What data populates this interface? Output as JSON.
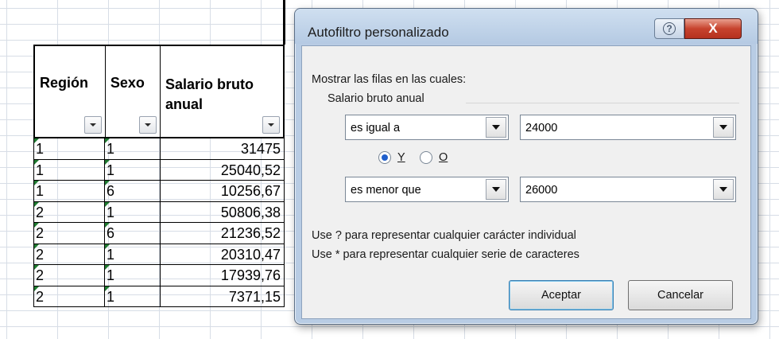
{
  "sheet": {
    "headers": [
      {
        "label": "Región"
      },
      {
        "label": "Sexo"
      },
      {
        "label_line1": "Salario bruto",
        "label_line2": "anual"
      }
    ],
    "rows": [
      {
        "region": "1",
        "sexo": "1",
        "salario": "31475"
      },
      {
        "region": "1",
        "sexo": "1",
        "salario": "25040,52"
      },
      {
        "region": "1",
        "sexo": "6",
        "salario": "10256,67"
      },
      {
        "region": "2",
        "sexo": "1",
        "salario": "50806,38"
      },
      {
        "region": "2",
        "sexo": "6",
        "salario": "21236,52"
      },
      {
        "region": "2",
        "sexo": "1",
        "salario": "20310,47"
      },
      {
        "region": "2",
        "sexo": "1",
        "salario": "17939,76"
      },
      {
        "region": "2",
        "sexo": "1",
        "salario": "7371,15"
      }
    ]
  },
  "dialog": {
    "title": "Autofiltro personalizado",
    "help_glyph": "?",
    "close_glyph": "X",
    "prompt": "Mostrar las filas en las cuales:",
    "field_label": "Salario bruto anual",
    "condition1": {
      "operator": "es igual a",
      "value": "24000"
    },
    "logic": {
      "option_and": "Y",
      "option_or": "O",
      "selected": "Y"
    },
    "condition2": {
      "operator": "es menor que",
      "value": "26000"
    },
    "hint1": "Use ? para representar cualquier carácter individual",
    "hint2": "Use * para representar cualquier serie de caracteres",
    "ok_label": "Aceptar",
    "cancel_label": "Cancelar"
  }
}
